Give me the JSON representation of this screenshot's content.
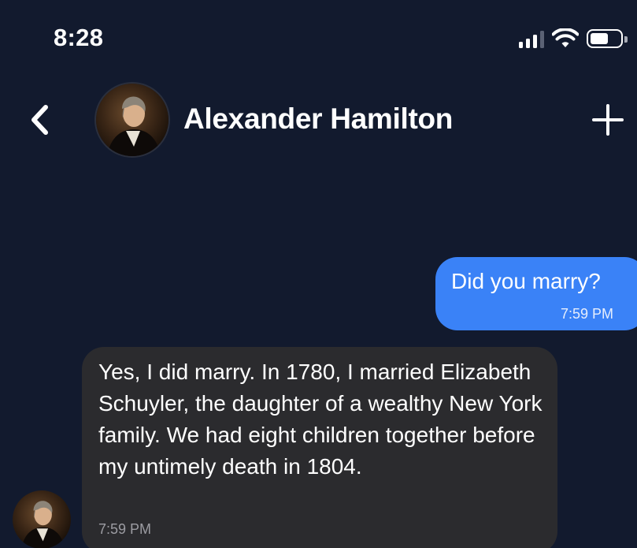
{
  "status_bar": {
    "time": "8:28",
    "signal_icon": "cellular-signal-icon",
    "wifi_icon": "wifi-icon",
    "battery_icon": "battery-icon"
  },
  "header": {
    "back_icon": "chevron-left-icon",
    "contact_name": "Alexander Hamilton",
    "add_icon": "plus-icon"
  },
  "colors": {
    "background": "#121a2e",
    "outgoing_bubble": "#3a82f7",
    "incoming_bubble": "#2b2b2e"
  },
  "messages": [
    {
      "direction": "outgoing",
      "text": "Did you marry?",
      "time": "7:59 PM"
    },
    {
      "direction": "incoming",
      "text": "Yes, I did marry. In 1780, I married Elizabeth Schuyler, the daughter of a wealthy New York family. We had eight children together before my untimely death in 1804.",
      "time": "7:59 PM"
    }
  ]
}
